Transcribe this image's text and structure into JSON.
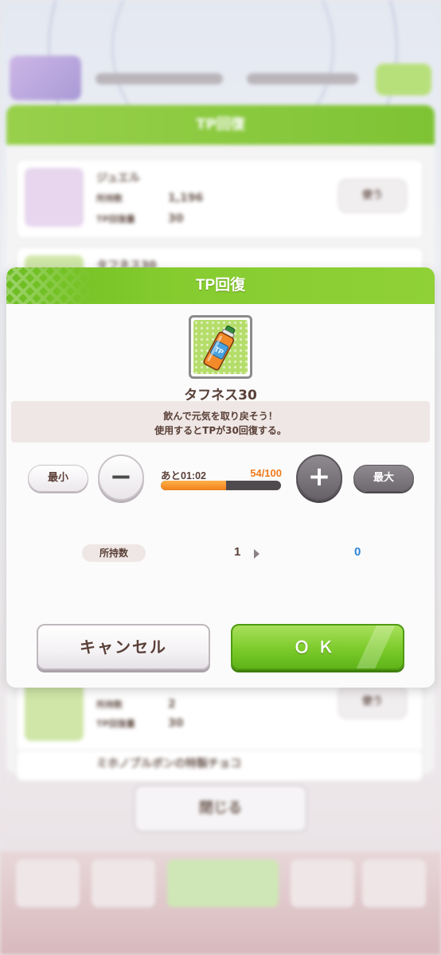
{
  "background": {
    "panel_title": "TP回復",
    "row1": {
      "name": "ジュエル",
      "owned_label": "所持数",
      "owned_value": "1,196",
      "tp_label": "TP回復量",
      "tp_value": "30",
      "use_label": "使う"
    },
    "row2": {
      "name": "タフネス30"
    },
    "row3": {
      "owned_label": "所持数",
      "owned_value": "2",
      "tp_label": "TP回復量",
      "tp_value": "30",
      "use_label": "使う"
    },
    "row4": {
      "name": "ミホノブルボンの特製チョコ"
    },
    "close_label": "閉じる"
  },
  "dialog": {
    "title": "TP回復",
    "item_icon": "tp-bottle-icon",
    "item_name": "タフネス30",
    "description": [
      "飲んで元気を取り戻そう！",
      "使用するとTPが30回復する。"
    ],
    "min_label": "最小",
    "max_label": "最大",
    "minus_symbol": "−",
    "plus_symbol": "+",
    "time_remaining": "あと01:02",
    "tp_current": 54,
    "tp_max": 100,
    "tp_text": "54/100",
    "owned_label": "所持数",
    "owned_current": "1",
    "owned_after": "0",
    "cancel_label": "キャンセル",
    "ok_label": "ＯＫ"
  },
  "colors": {
    "header_green": "#86cc2f",
    "ok_green": "#7ccb2b",
    "tp_orange": "#f07a1a",
    "after_blue": "#2f84d8",
    "text_brown": "#5a4038"
  }
}
